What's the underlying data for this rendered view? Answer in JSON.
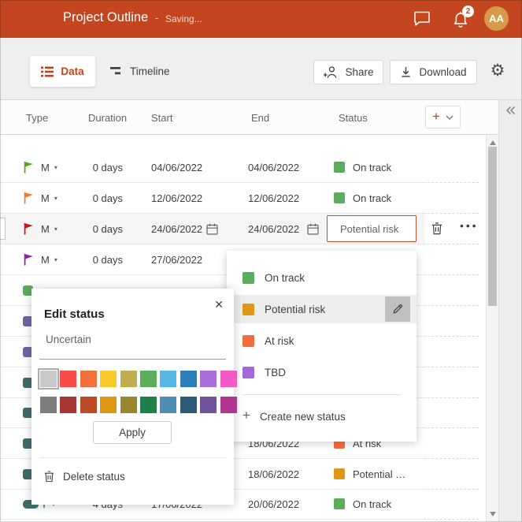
{
  "topbar": {
    "title": "Project Outline",
    "separator": "-",
    "saving": "Saving...",
    "notification_count": "2",
    "avatar_initials": "AA",
    "background": "#C3461F",
    "avatar_background": "#D59B4B"
  },
  "tabs": {
    "data": "Data",
    "timeline": "Timeline"
  },
  "toolbar": {
    "share": "Share",
    "download": "Download"
  },
  "table": {
    "columns": [
      "Type",
      "Duration",
      "Start",
      "End",
      "Status"
    ]
  },
  "rows": [
    {
      "icon": "flag",
      "color": "#4FA81E",
      "type": "M",
      "duration": "0 days",
      "start": "04/06/2022",
      "end": "04/06/2022",
      "status": "On track",
      "status_color": "#5BAD5B"
    },
    {
      "icon": "flag",
      "color": "#F07D26",
      "type": "M",
      "duration": "0 days",
      "start": "12/06/2022",
      "end": "12/06/2022",
      "status": "On track",
      "status_color": "#5BAD5B"
    },
    {
      "icon": "flag",
      "color": "#C11414",
      "type": "M",
      "duration": "0 days",
      "start": "24/06/2022",
      "end": "24/06/2022",
      "status": "Potential risk",
      "selected": true
    },
    {
      "icon": "flag",
      "color": "#8E24AA",
      "type": "M",
      "duration": "0 days",
      "start": "27/06/2022",
      "end": "",
      "status": ""
    },
    {
      "icon": "square",
      "color": "#5BAD5B",
      "type": "",
      "duration": "",
      "start": "",
      "end": "",
      "status": ""
    },
    {
      "icon": "square",
      "color": "#6F62A5",
      "type": "",
      "duration": "",
      "start": "",
      "end": "",
      "status": ""
    },
    {
      "icon": "square",
      "color": "#6F62A5",
      "type": "",
      "duration": "",
      "start": "",
      "end": "",
      "status": ""
    },
    {
      "icon": "square",
      "color": "#3D6B6B",
      "type": "",
      "duration": "",
      "start": "",
      "end": "",
      "status": ""
    },
    {
      "icon": "square",
      "color": "#3D6B6B",
      "type": "",
      "duration": "",
      "start": "",
      "end": "",
      "status": ""
    },
    {
      "icon": "square",
      "color": "#3D6B6B",
      "type": "",
      "duration": "",
      "start": "",
      "end": "18/06/2022",
      "status": "At risk",
      "status_color": "#F26C40"
    },
    {
      "icon": "square",
      "color": "#3D6B6B",
      "type": "",
      "duration": "",
      "start": "",
      "end": "18/06/2022",
      "status": "Potential …",
      "status_color": "#E09713"
    },
    {
      "icon": "pill",
      "color": "#3D6B6B",
      "type": "T",
      "duration": "4 days",
      "start": "17/06/2022",
      "end": "20/06/2022",
      "status": "On track",
      "status_color": "#5BAD5B"
    }
  ],
  "status_menu": {
    "items": [
      {
        "label": "On track",
        "color": "#5BAD5B"
      },
      {
        "label": "Potential risk",
        "color": "#E09713"
      },
      {
        "label": "At risk",
        "color": "#F26C40"
      },
      {
        "label": "TBD",
        "color": "#A369D8"
      }
    ],
    "create_label": "Create new status"
  },
  "edit_popup": {
    "title": "Edit status",
    "input_value": "Uncertain",
    "apply_label": "Apply",
    "delete_label": "Delete status",
    "palette_row1": [
      "#C9C9C9",
      "#F94C47",
      "#F2703C",
      "#F8C929",
      "#BFAE4E",
      "#5CAD5C",
      "#56B6E4",
      "#2B80B9",
      "#A76EDC",
      "#F25BC6"
    ],
    "palette_row2": [
      "#7D7D7D",
      "#A63732",
      "#BD4A26",
      "#DE9713",
      "#97882F",
      "#1F8048",
      "#4E8DB6",
      "#2C5B7A",
      "#6F5499",
      "#B23590"
    ]
  },
  "icons": {
    "caret": "▾",
    "close": "✕",
    "plus": "+",
    "ellipsis": "•••"
  }
}
